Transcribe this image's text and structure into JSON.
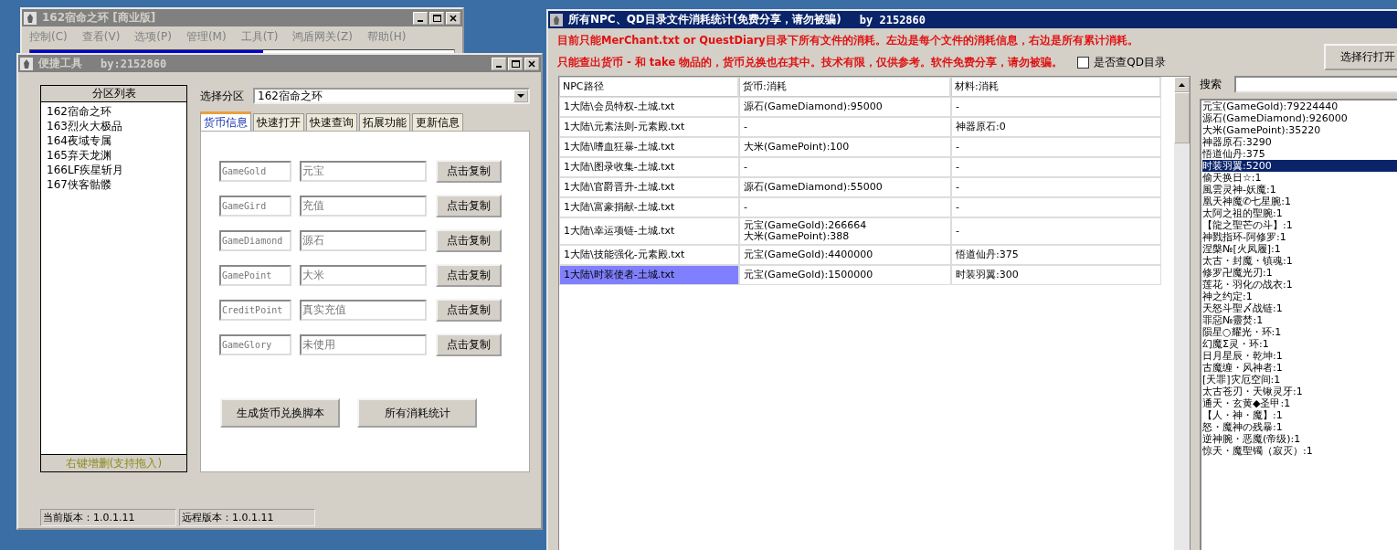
{
  "back_window": {
    "title": "162宿命之环 [商业版]",
    "menu": [
      "控制(C)",
      "查看(V)",
      "选项(P)",
      "管理(M)",
      "工具(T)",
      "鸿盾网关(Z)",
      "帮助(H)"
    ]
  },
  "tool_window": {
    "title": "便捷工具",
    "author": "by:2152860",
    "partition_list": {
      "header": "分区列表",
      "items": [
        "162宿命之环",
        "163烈火大极品",
        "164夜域专属",
        "165弃天龙渊",
        "166LF疾星斩月",
        "167侠客骷髅"
      ],
      "footer": "右键增删(支持拖入)"
    },
    "select_label": "选择分区",
    "select_value": "162宿命之环",
    "tabs": [
      {
        "label": "货币信息",
        "selected": true
      },
      {
        "label": "快速打开",
        "selected": false
      },
      {
        "label": "快速查询",
        "selected": false
      },
      {
        "label": "拓展功能",
        "selected": false
      },
      {
        "label": "更新信息",
        "selected": false
      }
    ],
    "currency_rows": [
      {
        "key": "GameGold",
        "value": "元宝",
        "button": "点击复制"
      },
      {
        "key": "GameGird",
        "value": "充值",
        "button": "点击复制"
      },
      {
        "key": "GameDiamond",
        "value": "源石",
        "button": "点击复制"
      },
      {
        "key": "GamePoint",
        "value": "大米",
        "button": "点击复制"
      },
      {
        "key": "CreditPoint",
        "value": "真实充值",
        "button": "点击复制"
      },
      {
        "key": "GameGlory",
        "value": "未使用",
        "button": "点击复制"
      }
    ],
    "buttons": [
      "生成货币兑换脚本",
      "所有消耗统计"
    ],
    "status": [
      "当前版本：1.0.1.11",
      "远程版本：1.0.1.11"
    ]
  },
  "stats_window": {
    "title": "所有NPC、QD目录文件消耗统计(免费分享，请勿被骗)",
    "author": "by 2152860",
    "notes": [
      "目前只能MerChant.txt or QuestDiary目录下所有文件的消耗。左边是每个文件的消耗信息，右边是所有累计消耗。",
      "只能查出货币 - 和 take 物品的，货币兑换也在其中。技术有限，仅供参考。软件免费分享，请勿被骗。"
    ],
    "qd_checkbox": {
      "label": "是否查QD目录",
      "checked": false
    },
    "open_button": "选择行打开",
    "table": {
      "columns": [
        "NPC路径",
        "货币:消耗",
        "材料:消耗"
      ],
      "rows": [
        {
          "cells": [
            "1大陆\\会员特权-土城.txt",
            "源石(GameDiamond):95000",
            "-"
          ],
          "selected": false
        },
        {
          "cells": [
            "1大陆\\元素法则-元素殿.txt",
            "-",
            "神器原石:0"
          ],
          "selected": false
        },
        {
          "cells": [
            "1大陆\\嗜血狂暴-土城.txt",
            "大米(GamePoint):100",
            "-"
          ],
          "selected": false
        },
        {
          "cells": [
            "1大陆\\图录收集-土城.txt",
            "-",
            "-"
          ],
          "selected": false
        },
        {
          "cells": [
            "1大陆\\官爵晋升-土城.txt",
            "源石(GameDiamond):55000",
            "-"
          ],
          "selected": false
        },
        {
          "cells": [
            "1大陆\\富豪捐献-土城.txt",
            "-",
            "-"
          ],
          "selected": false
        },
        {
          "cells": [
            "1大陆\\幸运项链-土城.txt",
            "元宝(GameGold):266664\n大米(GamePoint):388",
            "-"
          ],
          "selected": false
        },
        {
          "cells": [
            "1大陆\\技能强化-元素殿.txt",
            "元宝(GameGold):4400000",
            "悟道仙丹:375"
          ],
          "selected": false
        },
        {
          "cells": [
            "1大陆\\时装使者-土城.txt",
            "元宝(GameGold):1500000",
            "时装羽翼:300"
          ],
          "selected": true
        }
      ]
    },
    "search_label": "搜索",
    "totals": [
      {
        "label": "元宝(GameGold):79224440",
        "selected": false
      },
      {
        "label": "源石(GameDiamond):926000",
        "selected": false
      },
      {
        "label": "大米(GamePoint):35220",
        "selected": false
      },
      {
        "label": "神器原石:3290",
        "selected": false
      },
      {
        "label": "悟道仙丹:375",
        "selected": false
      },
      {
        "label": "时装羽翼:5200",
        "selected": true
      },
      {
        "label": "偷天换日☆:1",
        "selected": false
      },
      {
        "label": "風雲灵神-妖魔:1",
        "selected": false
      },
      {
        "label": "凰天神魔✆七星腕:1",
        "selected": false
      },
      {
        "label": "太阿之祖的聖腕:1",
        "selected": false
      },
      {
        "label": "【龍之聖芒の斗】:1",
        "selected": false
      },
      {
        "label": "神戮指环-阿修罗:1",
        "selected": false
      },
      {
        "label": "涅槃№[火凤履]:1",
        "selected": false
      },
      {
        "label": "太古・封魔・镇魂:1",
        "selected": false
      },
      {
        "label": "修罗卍魔光刃:1",
        "selected": false
      },
      {
        "label": "莲花・羽化の战衣:1",
        "selected": false
      },
      {
        "label": "神之约定:1",
        "selected": false
      },
      {
        "label": "天怒斗聖〆战链:1",
        "selected": false
      },
      {
        "label": "罪惡№靈焚:1",
        "selected": false
      },
      {
        "label": "陨星○耀光・环:1",
        "selected": false
      },
      {
        "label": "幻魔Σ灵・环:1",
        "selected": false
      },
      {
        "label": "日月星辰・乾坤:1",
        "selected": false
      },
      {
        "label": "古魔缠・风神者:1",
        "selected": false
      },
      {
        "label": "[天罪]灾厄空间:1",
        "selected": false
      },
      {
        "label": "太古苍刃・天锹灵牙:1",
        "selected": false
      },
      {
        "label": "通天・玄黄◆圣甲:1",
        "selected": false
      },
      {
        "label": "【人・神・魔】:1",
        "selected": false
      },
      {
        "label": "怒・魔神の残暴:1",
        "selected": false
      },
      {
        "label": "逆神腕・恶魔(帝级):1",
        "selected": false
      },
      {
        "label": "惊天・魔聖镯（寂灭）:1",
        "selected": false
      }
    ]
  }
}
